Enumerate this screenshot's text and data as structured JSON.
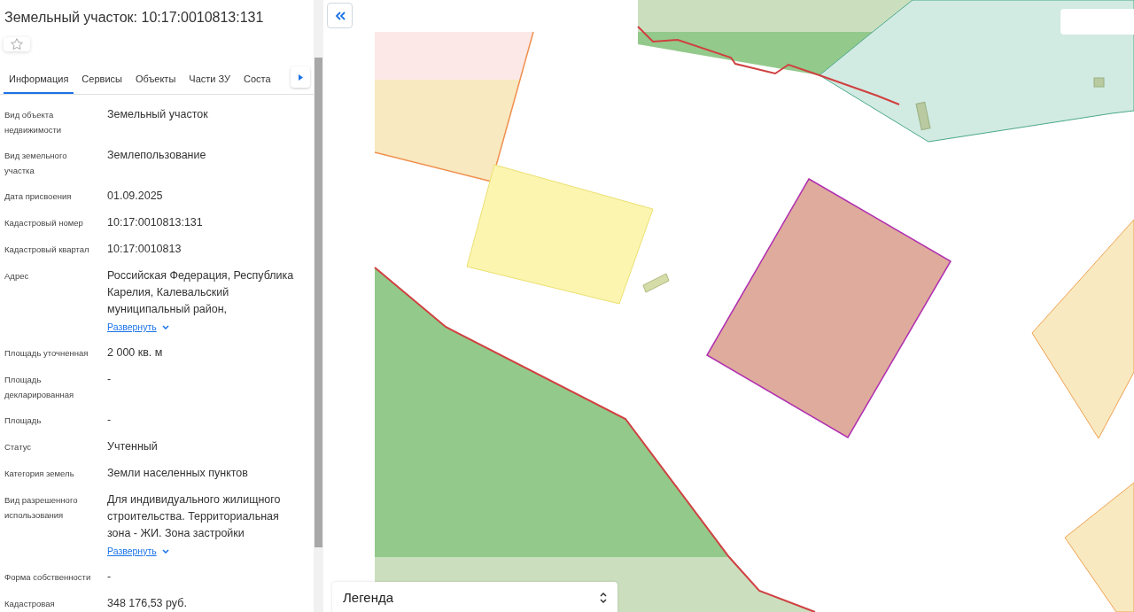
{
  "panel": {
    "title": "Земельный участок: 10:17:0010813:131",
    "favorite": false,
    "tabs": [
      {
        "label": "Информация",
        "selected": true
      },
      {
        "label": "Сервисы",
        "selected": false
      },
      {
        "label": "Объекты",
        "selected": false
      },
      {
        "label": "Части ЗУ",
        "selected": false
      },
      {
        "label": "Соста",
        "selected": false
      }
    ],
    "rows": [
      {
        "label": "Вид объекта недвижимости",
        "value": "Земельный участок"
      },
      {
        "label": "Вид земельного участка",
        "value": "Землепользование"
      },
      {
        "label": "Дата присвоения",
        "value": "01.09.2025"
      },
      {
        "label": "Кадастровый номер",
        "value": "10:17:0010813:131"
      },
      {
        "label": "Кадастровый квартал",
        "value": "10:17:0010813"
      },
      {
        "label": "Адрес",
        "value": "Российская Федерация, Республика Карелия, Калевальский муниципальный район,",
        "expand": "Развернуть"
      },
      {
        "label": "Площадь уточненная",
        "value": "2 000 кв. м"
      },
      {
        "label": "Площадь декларированная",
        "value": "-"
      },
      {
        "label": "Площадь",
        "value": "-"
      },
      {
        "label": "Статус",
        "value": "Учтенный"
      },
      {
        "label": "Категория земель",
        "value": "Земли населенных пунктов"
      },
      {
        "label": "Вид разрешенного использования",
        "value": "Для индивидуального жилищного строительства. Территориальная зона - ЖИ. Зона застройки",
        "expand": "Развернуть"
      },
      {
        "label": "Форма собственности",
        "value": "-"
      },
      {
        "label": "Кадастровая",
        "value": "348 176,53 руб."
      }
    ]
  },
  "map": {
    "legend": "Легенда"
  }
}
